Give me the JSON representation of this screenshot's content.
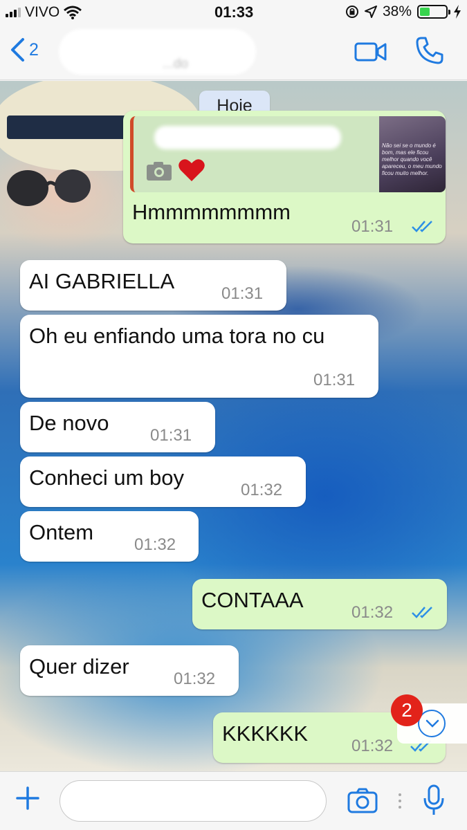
{
  "status_bar": {
    "carrier": "VIVO",
    "time": "01:33",
    "battery": "38%",
    "battery_level": 0.38
  },
  "nav": {
    "back_count": "2",
    "contact_status": "...do"
  },
  "chat": {
    "date_label": "Hoje",
    "quoted_preview_text": "Não sei se o mundo é bom, mas ele ficou melhor quando você apareceu, o meu mundo ficou muito melhor.",
    "messages": [
      {
        "direction": "out",
        "text": "Hmmmmmmmm",
        "time": "01:31",
        "read": true
      },
      {
        "direction": "in",
        "text": "AI GABRIELLA",
        "time": "01:31"
      },
      {
        "direction": "in",
        "text": "Oh eu enfiando uma tora no cu",
        "time": "01:31"
      },
      {
        "direction": "in",
        "text": "De novo",
        "time": "01:31"
      },
      {
        "direction": "in",
        "text": "Conheci um boy",
        "time": "01:32"
      },
      {
        "direction": "in",
        "text": "Ontem",
        "time": "01:32"
      },
      {
        "direction": "out",
        "text": "CONTAAA",
        "time": "01:32",
        "read": true
      },
      {
        "direction": "in",
        "text": "Quer dizer",
        "time": "01:32"
      },
      {
        "direction": "out",
        "text": "KKKKKK",
        "time": "01:32",
        "read": true
      }
    ],
    "unread_count": "2"
  },
  "input": {
    "placeholder": ""
  },
  "colors": {
    "accent": "#1f7ae0",
    "outgoing_bubble": "#dcf8c6",
    "incoming_bubble": "#ffffff",
    "badge": "#e2231a"
  },
  "icons": {
    "back": "chevron-left-icon",
    "video": "video-camera-icon",
    "call": "phone-icon",
    "photo": "camera-icon",
    "heart": "heart-icon",
    "ticks": "double-check-icon",
    "scroll": "chevron-down-icon",
    "attach": "plus-icon",
    "mic": "microphone-icon"
  }
}
